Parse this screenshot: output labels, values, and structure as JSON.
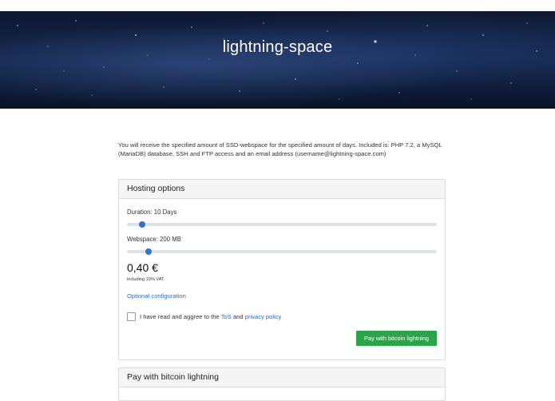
{
  "hero": {
    "title": "lightning-space"
  },
  "intro": {
    "text": "You will receive the specified amount of SSD-webspace for the specified amount of days. Included is: PHP 7.2, a MySQL (MariaDB) database, SSH and FTP access and an email address (username@lightning-space.com)"
  },
  "hosting": {
    "header": "Hosting options",
    "duration": {
      "label": "Duration: 10 Days",
      "level": 0.04
    },
    "webspace": {
      "label": "Webspace: 200 MB",
      "level": 0.06
    },
    "price": "0,40 €",
    "vat": "including 19% VAT",
    "optional_link": "Optional configuration",
    "tos": {
      "prefix": "I have read and aggree to the ",
      "tos_link": "ToS",
      "middle": " and ",
      "privacy_link": "privacy policy"
    },
    "pay_button": "Pay with bitcoin lightning"
  },
  "pay_section": {
    "header": "Pay with bitcoin lightning"
  },
  "colors": {
    "accent": "#3273c8",
    "button": "#2aa449",
    "link": "#2f6bbf"
  }
}
